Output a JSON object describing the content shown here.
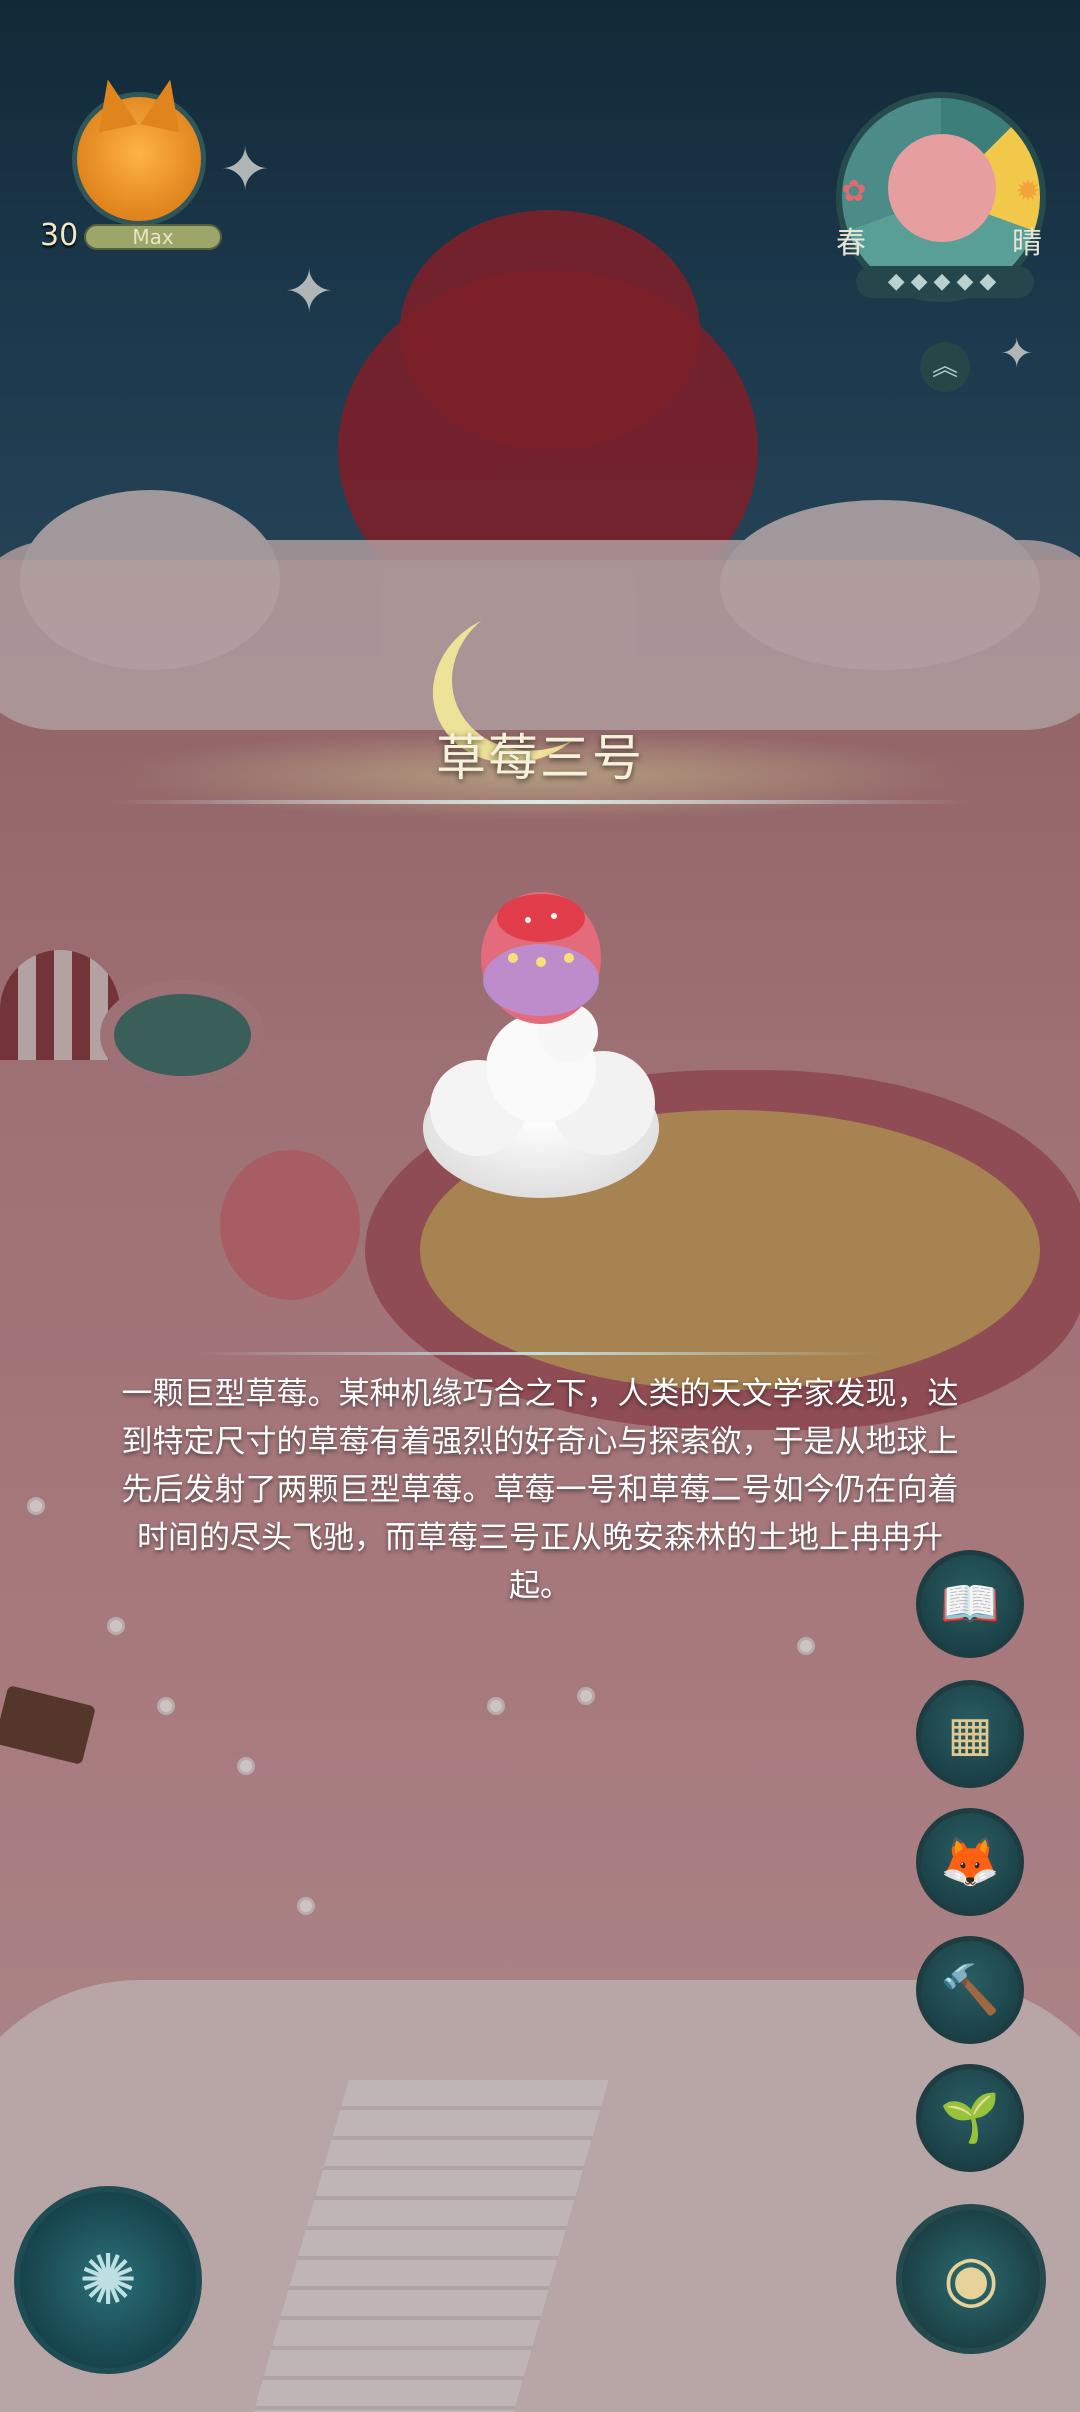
{
  "player": {
    "level": "30",
    "level_status": "Max",
    "avatar_icon": "fox-avatar-icon"
  },
  "season": {
    "season_label": "春",
    "weather_label": "晴",
    "stars": "◆◆◆◆◆"
  },
  "item": {
    "name": "草莓三号",
    "description": "一颗巨型草莓。某种机缘巧合之下，人类的天文学家发现，达到特定尺寸的草莓有着强烈的好奇心与探索欲，于是从地球上先后发射了两颗巨型草莓。草莓一号和草莓二号如今仍在向着时间的尽头飞驰，而草莓三号正从晚安森林的土地上冉冉升起。"
  },
  "side_buttons": [
    {
      "name": "book-button",
      "icon": "book-icon",
      "glyph": "📖"
    },
    {
      "name": "blocks-button",
      "icon": "blocks-icon",
      "glyph": "▦"
    },
    {
      "name": "character-button",
      "icon": "fox-icon",
      "glyph": "🦊"
    },
    {
      "name": "hammer-button",
      "icon": "hammer-icon",
      "glyph": "🔨"
    },
    {
      "name": "plant-button",
      "icon": "sprout-icon",
      "glyph": "🌱"
    }
  ],
  "colors": {
    "title_text": "#f7f1da",
    "button_bg": "#1a4147",
    "sky_top": "#0e2a3c"
  }
}
